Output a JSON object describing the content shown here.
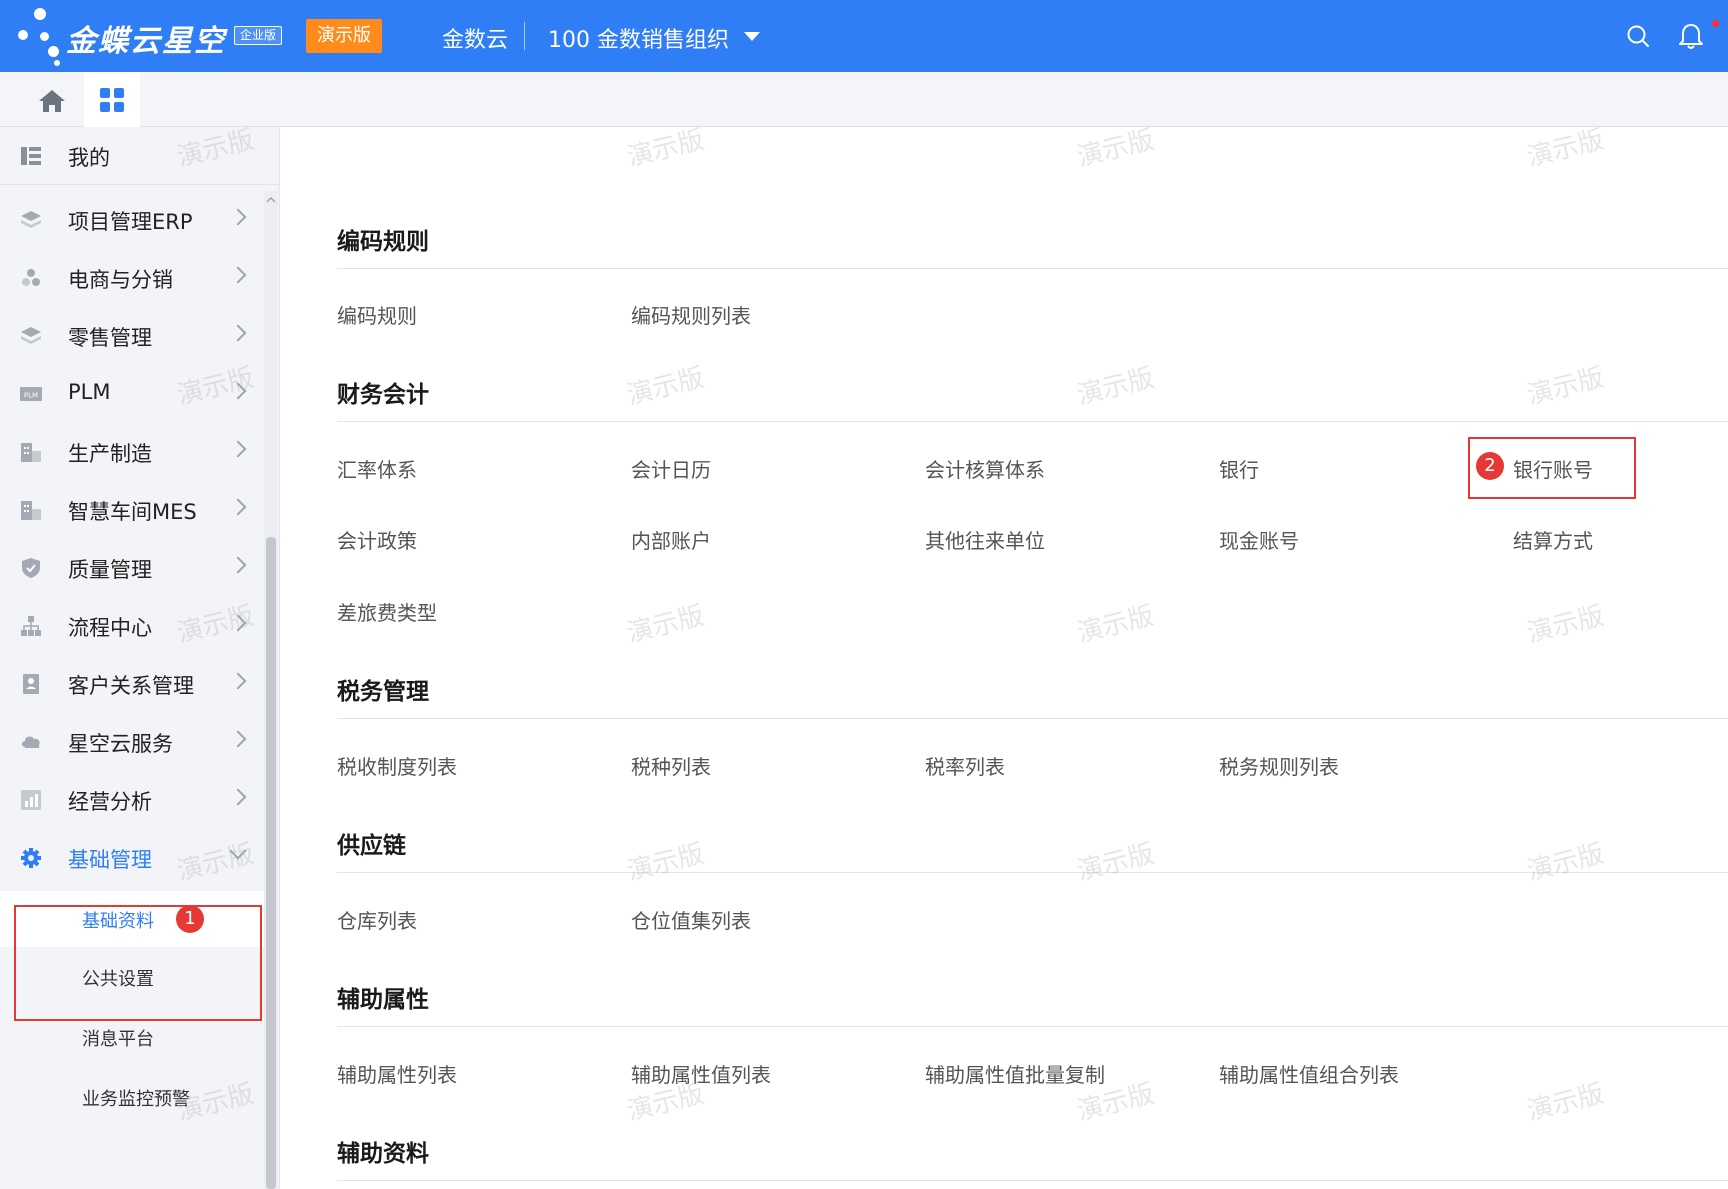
{
  "header": {
    "brand": "金蝶云星空",
    "edition": "企业版",
    "demo_badge": "演示版",
    "tenant": "金数云",
    "org": "100 金数销售组织",
    "icons": {
      "search": "search-icon",
      "notifications": "bell-icon",
      "org_dropdown": "caret-down-icon"
    },
    "colors": {
      "bar": "#2f7ef5",
      "badge": "#ff8c1a"
    }
  },
  "tabs": {
    "home": "home-icon",
    "apps": "apps-grid-icon"
  },
  "sidebar": {
    "my": "我的",
    "items": [
      {
        "label": "项目管理ERP",
        "icon": "layers-icon"
      },
      {
        "label": "电商与分销",
        "icon": "cubes-icon"
      },
      {
        "label": "零售管理",
        "icon": "layers-icon"
      },
      {
        "label": "PLM",
        "icon": "plm-icon"
      },
      {
        "label": "生产制造",
        "icon": "factory-icon"
      },
      {
        "label": "智慧车间MES",
        "icon": "factory-icon"
      },
      {
        "label": "质量管理",
        "icon": "shield-icon"
      },
      {
        "label": "流程中心",
        "icon": "flow-icon"
      },
      {
        "label": "客户关系管理",
        "icon": "contact-icon"
      },
      {
        "label": "星空云服务",
        "icon": "cloud-icon"
      },
      {
        "label": "经营分析",
        "icon": "chart-icon"
      },
      {
        "label": "基础管理",
        "icon": "gear-icon"
      }
    ],
    "sub_items": [
      "基础资料",
      "公共设置",
      "消息平台",
      "业务监控预警"
    ],
    "step1": "1"
  },
  "main": {
    "sections": [
      {
        "title": "编码规则",
        "links": [
          "编码规则",
          "编码规则列表"
        ]
      },
      {
        "title": "财务会计",
        "links": [
          "汇率体系",
          "会计日历",
          "会计核算体系",
          "银行",
          "银行账号",
          "会计政策",
          "内部账户",
          "其他往来单位",
          "现金账号",
          "结算方式",
          "差旅费类型"
        ]
      },
      {
        "title": "税务管理",
        "links": [
          "税收制度列表",
          "税种列表",
          "税率列表",
          "税务规则列表"
        ]
      },
      {
        "title": "供应链",
        "links": [
          "仓库列表",
          "仓位值集列表"
        ]
      },
      {
        "title": "辅助属性",
        "links": [
          "辅助属性列表",
          "辅助属性值列表",
          "辅助属性值批量复制",
          "辅助属性值组合列表"
        ]
      },
      {
        "title": "辅助资料",
        "links": []
      }
    ],
    "step2": "2"
  },
  "watermark": "演示版"
}
